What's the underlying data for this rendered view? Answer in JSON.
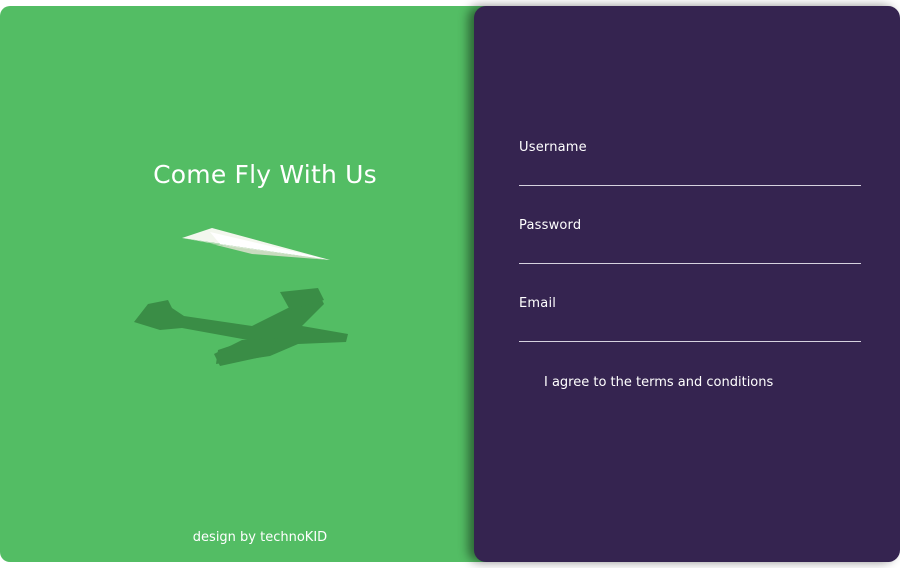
{
  "hero": {
    "title": "Come Fly With Us",
    "credit": "design by technoKID",
    "illustration": "paper-plane-with-airplane-shadow"
  },
  "form": {
    "fields": [
      {
        "label": "Username",
        "value": ""
      },
      {
        "label": "Password",
        "value": ""
      },
      {
        "label": "Email",
        "value": ""
      }
    ],
    "terms_label": "I agree to the terms and conditions"
  },
  "colors": {
    "left_panel": "#53bd64",
    "right_panel": "#352450",
    "text": "#ffffff",
    "underline": "#d6d2df"
  }
}
